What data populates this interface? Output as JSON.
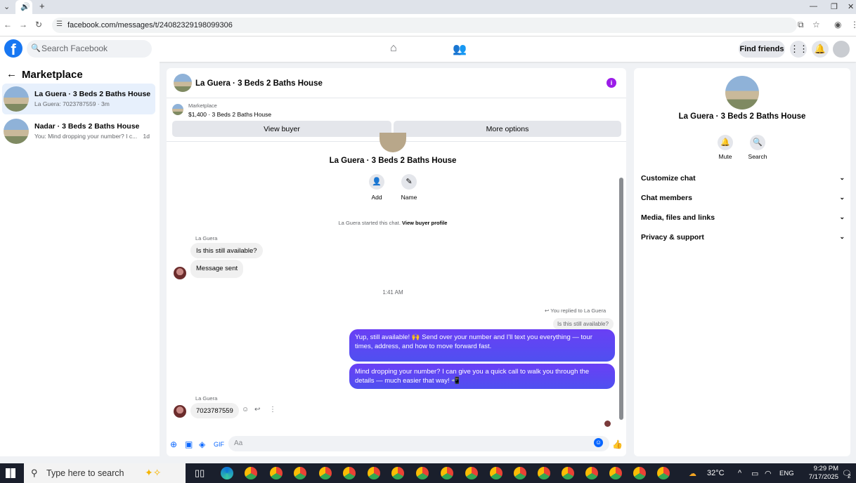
{
  "browser": {
    "url": "facebook.com/messages/t/24082329198099306"
  },
  "header": {
    "logo": "f",
    "search_placeholder": "Search Facebook",
    "find_friends": "Find friends"
  },
  "sidebar": {
    "title": "Marketplace",
    "conversations": [
      {
        "title": "La Guera · 3 Beds 2 Baths House",
        "snippet": "La Guera: 7023787559 · 3m"
      },
      {
        "title": "Nadar · 3 Beds 2 Baths House",
        "snippet": "You: Mind dropping your number? I c...",
        "time": "1d"
      }
    ]
  },
  "chat": {
    "title": "La Guera · 3 Beds 2 Baths House",
    "marketplace_label": "Marketplace",
    "listing": "$1,400 · 3 Beds 2 Baths House",
    "view_buyer": "View buyer",
    "more_options": "More options",
    "actions": [
      {
        "label": "Add"
      },
      {
        "label": "Name"
      }
    ],
    "started_text": "La Guera started this chat.",
    "view_buyer_profile": "View buyer profile",
    "sender_name": "La Guera",
    "msg_in_1": "Is this still available?",
    "msg_in_2": "Message sent",
    "time_divider": "1:41 AM",
    "replied_to": "You replied to La Guera",
    "quoted": "Is this still available?",
    "msg_out_1": "Yup, still available! 🙌 Send over your number and I'll text you everything — tour times, address, and how to move forward fast.",
    "msg_out_2": "Mind dropping your number? I can give you a quick call to walk you through the details — much easier that way! 📲",
    "sender_name_2": "La Guera",
    "msg_in_3": "7023787559",
    "composer_placeholder": "Aa"
  },
  "right_panel": {
    "title": "La Guera · 3 Beds 2 Baths House",
    "actions": [
      {
        "label": "Mute",
        "icon": "bell-icon"
      },
      {
        "label": "Search",
        "icon": "search-icon"
      }
    ],
    "sections": [
      "Customize chat",
      "Chat members",
      "Media, files and links",
      "Privacy & support"
    ]
  },
  "taskbar": {
    "search_placeholder": "Type here to search",
    "temperature": "32°C",
    "language": "ENG",
    "time": "9:29 PM",
    "date": "7/17/2025",
    "notifications": "2"
  },
  "colors": {
    "accent": "#0866ff",
    "outgoing_bubble": "#5b4ff3",
    "info_icon": "#9b1de8"
  }
}
